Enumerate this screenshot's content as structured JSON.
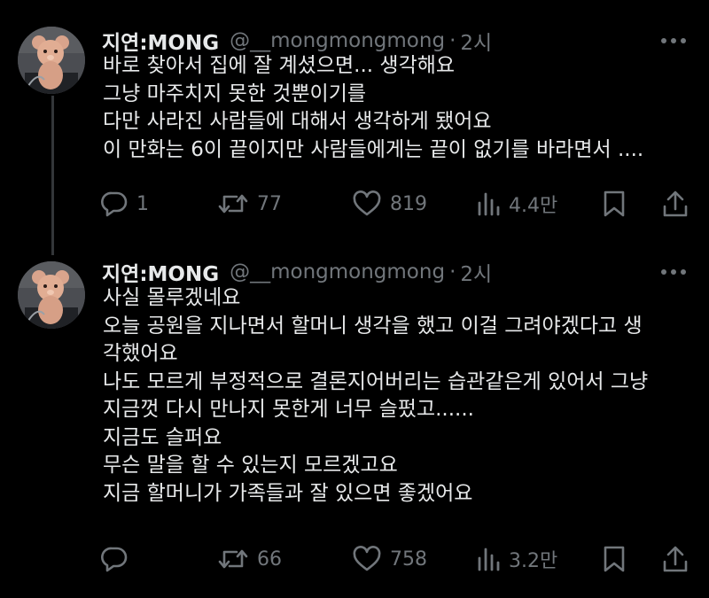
{
  "tweets": [
    {
      "display_name": "지연:MONG",
      "handle": "@__mongmongmong",
      "separator": "·",
      "time": "2시",
      "lines": [
        "바로 찾아서 집에 잘 계셨으면... 생각해요",
        "그냥 마주치지 못한 것뿐이기를",
        "다만 사라진 사람들에 대해서 생각하게 됐어요",
        "이 만화는 6이 끝이지만 사람들에게는 끝이 없기를 바라면서 ...."
      ],
      "replies": "1",
      "retweets": "77",
      "likes": "819",
      "views": "4.4만"
    },
    {
      "display_name": "지연:MONG",
      "handle": "@__mongmongmong",
      "separator": "·",
      "time": "2시",
      "lines": [
        "사실 몰루겠네요",
        "오늘 공원을 지나면서 할머니 생각을 했고 이걸 그려야겠다고 생",
        "각했어요",
        "나도 모르게 부정적으로 결론지어버리는 습관같은게 있어서 그냥",
        "지금껏 다시 만나지 못한게 너무 슬펐고......",
        "지금도 슬퍼요",
        "무슨 말을 할 수 있는지 모르겠고요",
        "지금 할머니가 가족들과 잘 있으면 좋겠어요"
      ],
      "replies": "",
      "retweets": "66",
      "likes": "758",
      "views": "3.2만"
    }
  ],
  "icons": {
    "reply": "reply-icon",
    "retweet": "retweet-icon",
    "like": "heart-icon",
    "views": "views-icon",
    "bookmark": "bookmark-icon",
    "share": "share-icon",
    "more": "more-icon",
    "avatar": "teddy-bear-avatar"
  },
  "colors": {
    "background": "#000000",
    "text": "#e7e9ea",
    "secondary": "#71767b",
    "thread_line": "#333639"
  }
}
